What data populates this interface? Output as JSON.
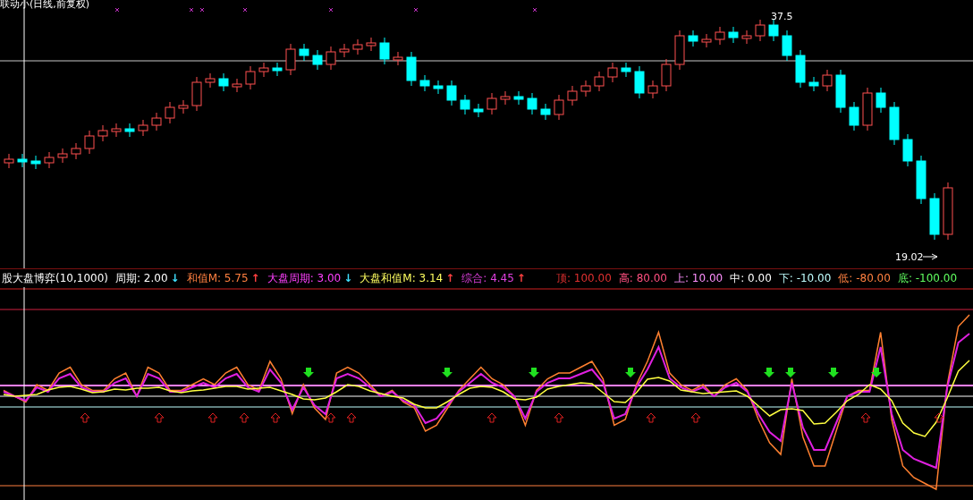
{
  "chart_title": "联动小(日线,前复权)",
  "price_labels": {
    "high": "37.5",
    "low": "19.02"
  },
  "indicator_title": "股大盘博弈(10,1000)",
  "indicator_values": [
    {
      "text": "周期: 2.00",
      "arrow": "↓",
      "kind": "falling",
      "color": "#ffffff"
    },
    {
      "text": "和值M: 5.75",
      "arrow": "↑",
      "kind": "rising",
      "color": "#ff8040"
    },
    {
      "text": "大盘周期: 3.00",
      "arrow": "↓",
      "kind": "falling",
      "color": "#ff40ff"
    },
    {
      "text": "大盘和值M: 3.14",
      "arrow": "↑",
      "kind": "rising",
      "color": "#ffff60"
    },
    {
      "text": "综合: 4.45",
      "arrow": "↑",
      "kind": "rising",
      "color": "#e040e0"
    }
  ],
  "levels": [
    {
      "text": "顶: 100.00",
      "color": "#e03030"
    },
    {
      "text": "高: 80.00",
      "color": "#ff5080"
    },
    {
      "text": "上: 10.00",
      "color": "#ff90ff"
    },
    {
      "text": "中: 0.00",
      "color": "#ffffff"
    },
    {
      "text": "下: -10.00",
      "color": "#c0ffff"
    },
    {
      "text": "低: -80.00",
      "color": "#ff8040"
    },
    {
      "text": "底: -100.00",
      "color": "#60ff60"
    }
  ]
}
